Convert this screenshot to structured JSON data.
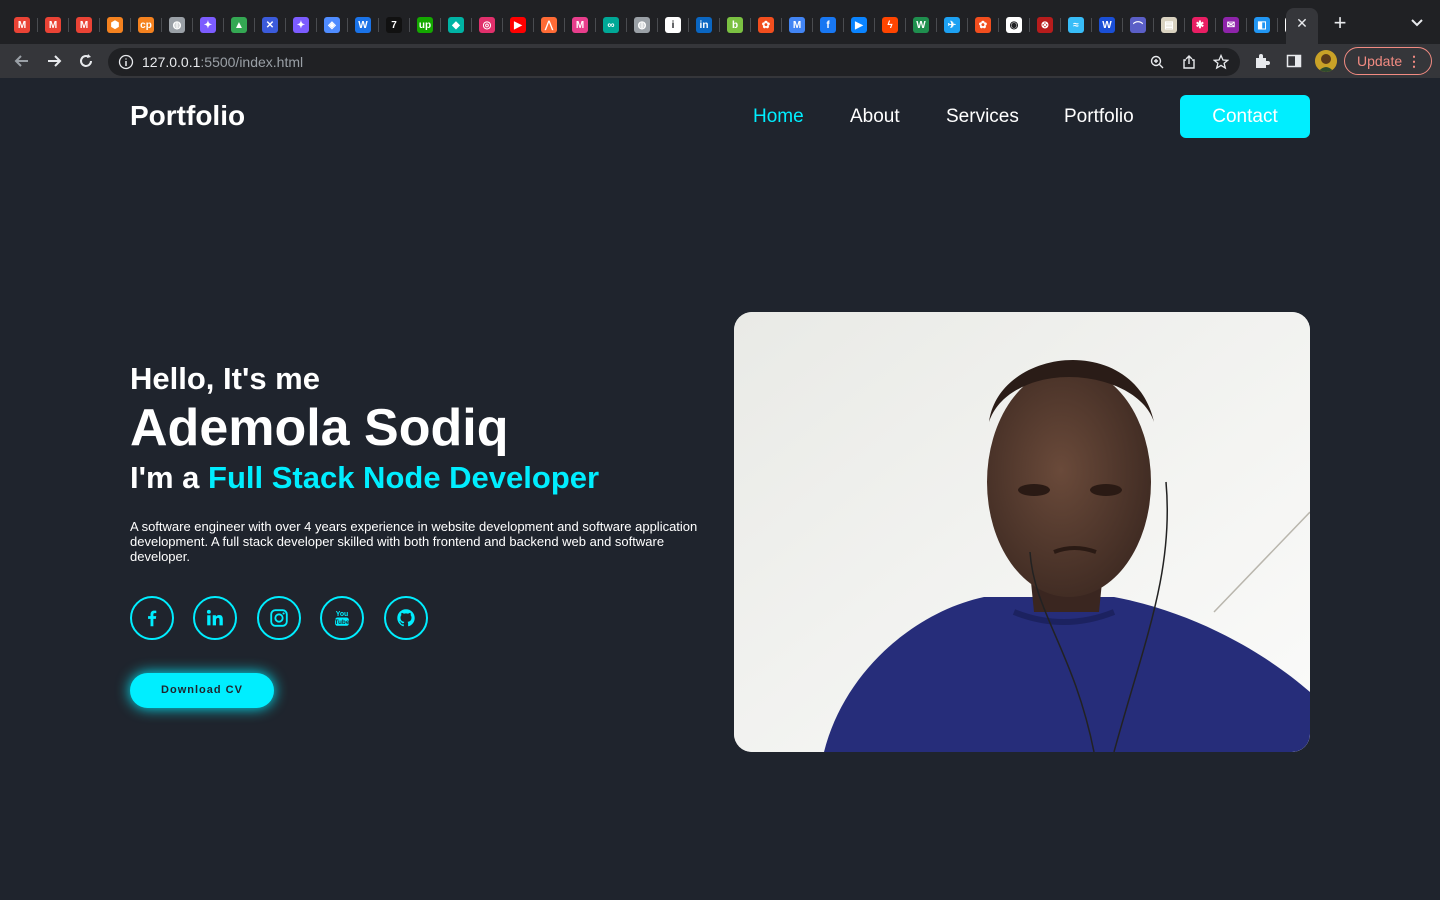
{
  "browser": {
    "url_host": "127.0.0.1",
    "url_path": ":5500/index.html",
    "update_label": "Update",
    "favicons": [
      {
        "icon": "gmail-icon",
        "color": "#ea4335",
        "glyph": "M"
      },
      {
        "icon": "gmail-icon",
        "color": "#ea4335",
        "glyph": "M"
      },
      {
        "icon": "gmail-icon",
        "color": "#ea4335",
        "glyph": "M"
      },
      {
        "icon": "package-icon",
        "color": "#f5821f",
        "glyph": "⬢"
      },
      {
        "icon": "cp-icon",
        "color": "#f5821f",
        "glyph": "cp"
      },
      {
        "icon": "globe-icon",
        "color": "#9aa0a6",
        "glyph": "◍"
      },
      {
        "icon": "sparkle-icon",
        "color": "#7c5cff",
        "glyph": "✦"
      },
      {
        "icon": "drive-icon",
        "color": "#34a853",
        "glyph": "▲"
      },
      {
        "icon": "x-box-icon",
        "color": "#3b5bdb",
        "glyph": "✕"
      },
      {
        "icon": "sparkle-icon",
        "color": "#7c5cff",
        "glyph": "✦"
      },
      {
        "icon": "location-icon",
        "color": "#4f8cff",
        "glyph": "◈"
      },
      {
        "icon": "w-icon",
        "color": "#1a73e8",
        "glyph": "W"
      },
      {
        "icon": "seven-icon",
        "color": "#111111",
        "glyph": "7"
      },
      {
        "icon": "upwork-icon",
        "color": "#14a800",
        "glyph": "up"
      },
      {
        "icon": "diamond-icon",
        "color": "#00b3a4",
        "glyph": "◆"
      },
      {
        "icon": "instagram-icon",
        "color": "#e1306c",
        "glyph": "◎"
      },
      {
        "icon": "youtube-icon",
        "color": "#ff0000",
        "glyph": "▶"
      },
      {
        "icon": "peaks-icon",
        "color": "#ff6b35",
        "glyph": "⋀"
      },
      {
        "icon": "m-logo-icon",
        "color": "#e83e8c",
        "glyph": "M"
      },
      {
        "icon": "loop-icon",
        "color": "#00a896",
        "glyph": "∞"
      },
      {
        "icon": "globe-icon",
        "color": "#9aa0a6",
        "glyph": "◍"
      },
      {
        "icon": "info-icon",
        "color": "#ffffff",
        "glyph": "i"
      },
      {
        "icon": "linkedin-icon",
        "color": "#0a66c2",
        "glyph": "in"
      },
      {
        "icon": "bootstrap-icon",
        "color": "#7bc142",
        "glyph": "b"
      },
      {
        "icon": "figma-icon",
        "color": "#f24e1e",
        "glyph": "✿"
      },
      {
        "icon": "gmail-icon",
        "color": "#4285f4",
        "glyph": "M"
      },
      {
        "icon": "facebook-icon",
        "color": "#1877f2",
        "glyph": "f"
      },
      {
        "icon": "play-icon",
        "color": "#0a84ff",
        "glyph": "▶"
      },
      {
        "icon": "bolt-icon",
        "color": "#ff4500",
        "glyph": "ϟ"
      },
      {
        "icon": "w-icon",
        "color": "#1f8f4e",
        "glyph": "W"
      },
      {
        "icon": "twitter-icon",
        "color": "#1da1f2",
        "glyph": "✈"
      },
      {
        "icon": "figma-icon",
        "color": "#f24e1e",
        "glyph": "✿"
      },
      {
        "icon": "github-icon",
        "color": "#ffffff",
        "glyph": "◉"
      },
      {
        "icon": "red-square-icon",
        "color": "#b71c1c",
        "glyph": "⊗"
      },
      {
        "icon": "tailwind-icon",
        "color": "#38bdf8",
        "glyph": "≈"
      },
      {
        "icon": "w-dark-icon",
        "color": "#1a4fd6",
        "glyph": "W"
      },
      {
        "icon": "rainbow-icon",
        "color": "#5b5fc7",
        "glyph": "⌒"
      },
      {
        "icon": "document-icon",
        "color": "#d9d2c0",
        "glyph": "▤"
      },
      {
        "icon": "star-icon",
        "color": "#e91e63",
        "glyph": "✱"
      },
      {
        "icon": "mail-icon",
        "color": "#8e24aa",
        "glyph": "✉"
      },
      {
        "icon": "box-icon",
        "color": "#2196f3",
        "glyph": "◧"
      },
      {
        "icon": "page-icon",
        "color": "#ffffff",
        "glyph": "▯"
      }
    ]
  },
  "site": {
    "logo": "Portfolio",
    "nav": [
      {
        "label": "Home",
        "active": true
      },
      {
        "label": "About",
        "active": false
      },
      {
        "label": "Services",
        "active": false
      },
      {
        "label": "Portfolio",
        "active": false
      }
    ],
    "contact_label": "Contact",
    "accent_color": "#00eeff",
    "background_color": "#1f242d"
  },
  "hero": {
    "greeting": "Hello, It's me",
    "name": "Ademola Sodiq",
    "role_prefix": "I'm a ",
    "role_highlight": "Full Stack Node Developer",
    "description": "A software engineer with over 4 years experience in website development and software application development. A full stack developer skilled with both frontend and backend web and software developer.",
    "social_icons": [
      "facebook-icon",
      "linkedin-icon",
      "instagram-icon",
      "youtube-icon",
      "github-icon"
    ],
    "download_label": "Download CV"
  }
}
